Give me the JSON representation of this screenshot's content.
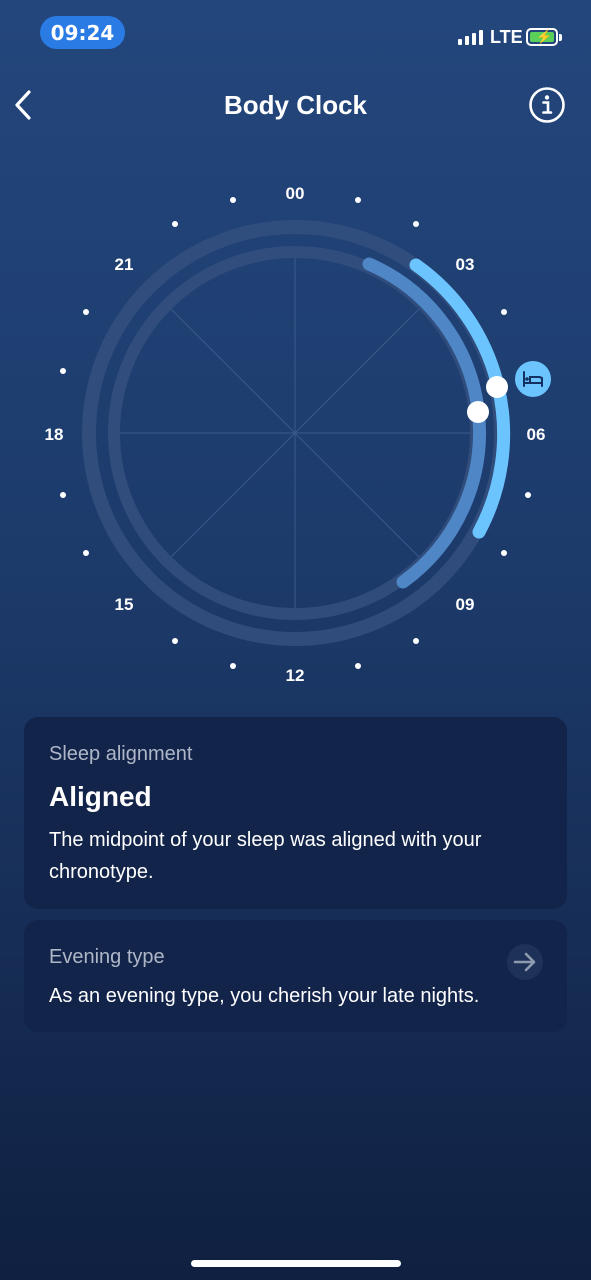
{
  "status_bar": {
    "time": "09:24",
    "network": "LTE"
  },
  "header": {
    "title": "Body Clock",
    "back_icon": "chevron-left-icon",
    "info_icon": "info-icon"
  },
  "clock": {
    "hour_labels": [
      "00",
      "03",
      "06",
      "09",
      "12",
      "15",
      "18",
      "21"
    ],
    "sleep_marker_icon": "bed-icon",
    "colors": {
      "track": "#34507f",
      "chronotype_arc": "#4f86c6",
      "sleep_arc": "#6cc4ff",
      "marker": "#ffffff"
    }
  },
  "sleep_alignment_card": {
    "label": "Sleep alignment",
    "status": "Aligned",
    "description": "The midpoint of your sleep was aligned with your chronotype."
  },
  "chronotype_card": {
    "label": "Evening type",
    "description": "As an evening type, you cherish your late nights.",
    "arrow_icon": "arrow-right-icon"
  }
}
